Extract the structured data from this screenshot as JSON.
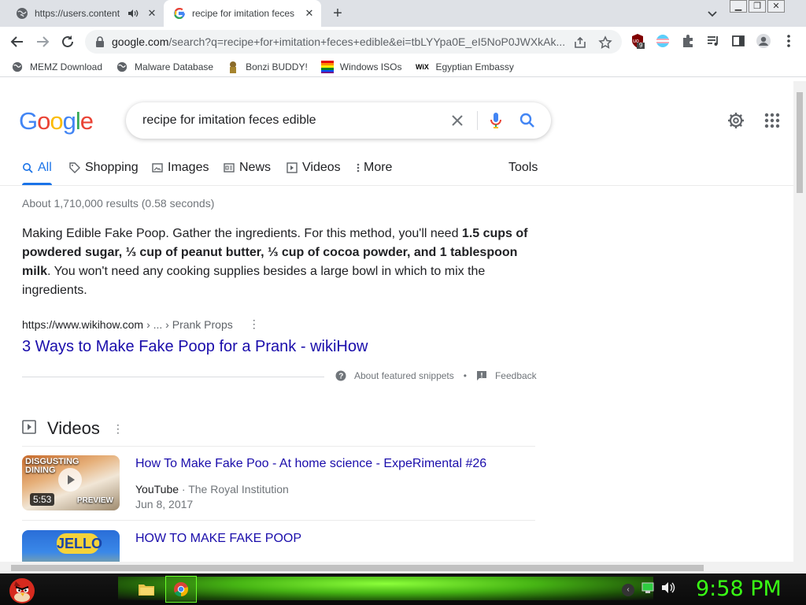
{
  "browser": {
    "tabs": [
      {
        "title": "https://users.content",
        "active": false
      },
      {
        "title": "recipe for imitation feces",
        "active": true
      }
    ],
    "omnibox": {
      "host": "google.com",
      "path": "/search?q=recipe+for+imitation+feces+edible&ei=tbLYYpa0E_eI5NoP0JWXkAk..."
    },
    "extension_badge": "9",
    "bookmarks": [
      {
        "label": "MEMZ Download",
        "icon": "globe-icon"
      },
      {
        "label": "Malware Database",
        "icon": "globe-icon"
      },
      {
        "label": "Bonzi BUDDY!",
        "icon": "bonzi-icon"
      },
      {
        "label": "Windows ISOs",
        "icon": "windows-flag-icon"
      },
      {
        "label": "Egyptian Embassy",
        "icon": "wix-icon"
      }
    ]
  },
  "google": {
    "logo": [
      "G",
      "o",
      "o",
      "g",
      "l",
      "e"
    ],
    "logo_colors": [
      "#4285f4",
      "#ea4335",
      "#fbbc05",
      "#4285f4",
      "#34a853",
      "#ea4335"
    ],
    "query": "recipe for imitation feces edible",
    "nav_tabs": [
      "All",
      "Shopping",
      "Images",
      "News",
      "Videos",
      "More"
    ],
    "tools_label": "Tools",
    "result_stats": "About 1,710,000 results (0.58 seconds)",
    "snippet": {
      "plain1": "Making Edible Fake Poop. Gather the ingredients. For this method, you'll need ",
      "bold": "1.5 cups of powdered sugar, ⅓ cup of peanut butter, ⅓ cup of cocoa powder, and 1 tablespoon milk",
      "plain2": ". You won't need any cooking supplies besides a large bowl in which to mix the ingredients."
    },
    "featured": {
      "cite_host": "https://www.wikihow.com",
      "cite_path": "› ... › Prank Props",
      "title": "3 Ways to Make Fake Poop for a Prank - wikiHow",
      "about_label": "About featured snippets",
      "dot": "•",
      "feedback_label": "Feedback"
    },
    "videos": {
      "heading": "Videos",
      "items": [
        {
          "title": "How To Make Fake Poo - At home science - ExpeRimental #26",
          "source": "YouTube",
          "separator": " · ",
          "channel": "The Royal Institution",
          "date": "Jun 8, 2017",
          "thumb_text_1": "DISGUSTING",
          "thumb_text_2": "DINING",
          "duration": "5:53",
          "preview_label": "PREVIEW"
        },
        {
          "title": "HOW TO MAKE FAKE POOP",
          "thumb_text_1": "JELLO"
        }
      ]
    }
  },
  "taskbar": {
    "clock": "9:58 PM",
    "accent_color": "#39ff14"
  }
}
